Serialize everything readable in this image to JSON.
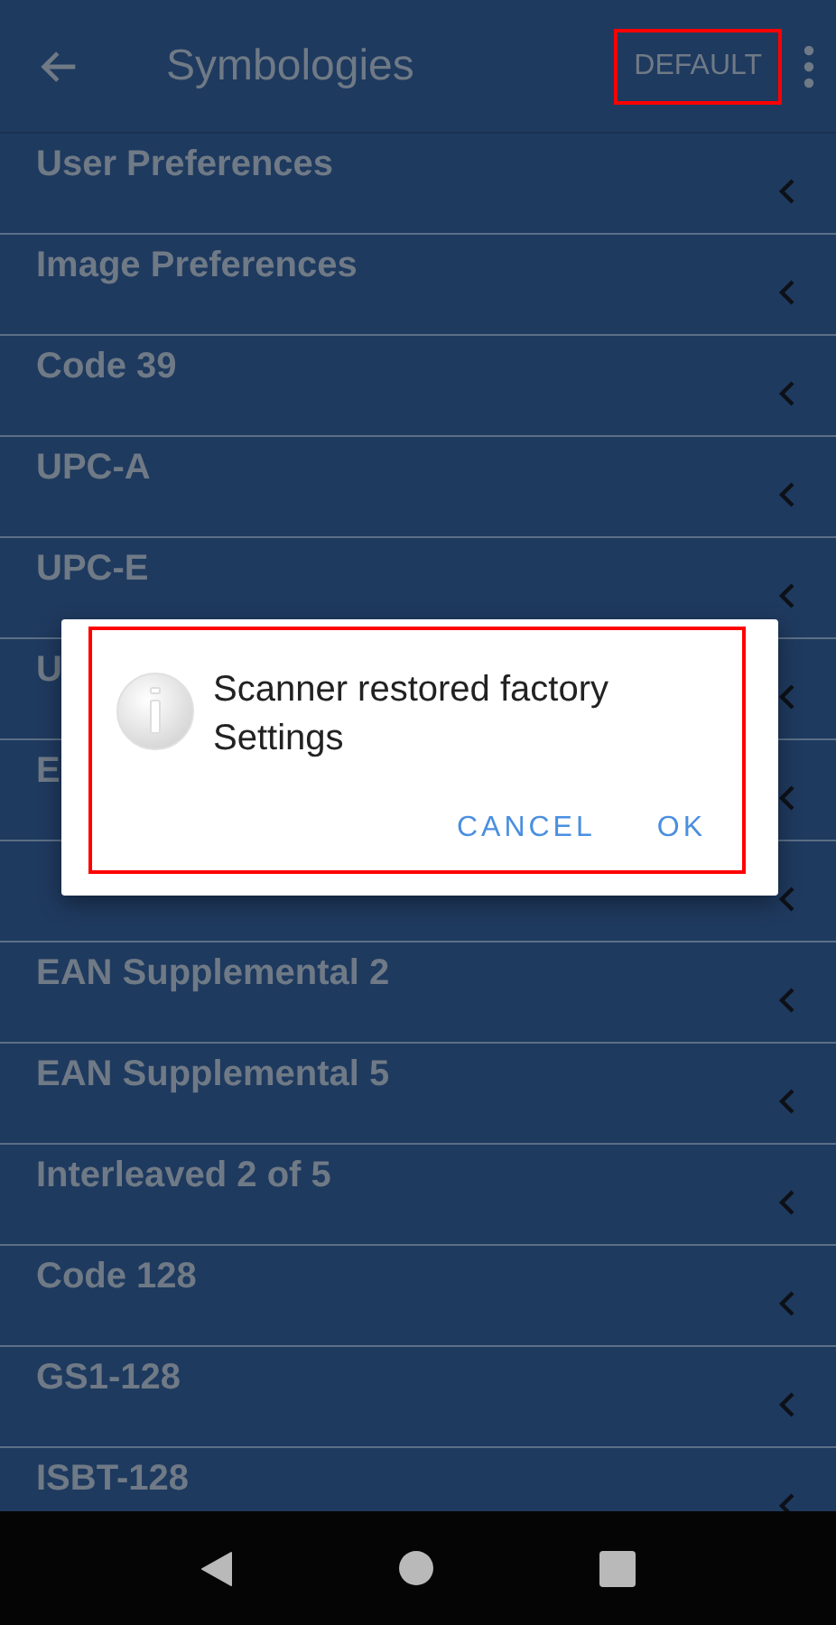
{
  "app_bar": {
    "title": "Symbologies",
    "action": {
      "label": "DEFAULT",
      "highlighted": true
    }
  },
  "items": [
    {
      "label": "User Preferences"
    },
    {
      "label": "Image Preferences"
    },
    {
      "label": "Code 39"
    },
    {
      "label": "UPC-A"
    },
    {
      "label": "UPC-E"
    },
    {
      "label": "U"
    },
    {
      "label": "E"
    },
    {
      "chevron": true
    },
    {
      "label": "EAN Supplemental 2"
    },
    {
      "label": "EAN Supplemental 5"
    },
    {
      "label": "Interleaved 2 of 5"
    },
    {
      "label": "Code 128"
    },
    {
      "label": "GS1-128"
    },
    {
      "label": "ISBT-128"
    }
  ],
  "dialog": {
    "message": "Scanner restored factory Settings",
    "highlighted": true,
    "buttons": [
      {
        "label": "CANCEL"
      },
      {
        "label": "OK"
      }
    ]
  }
}
